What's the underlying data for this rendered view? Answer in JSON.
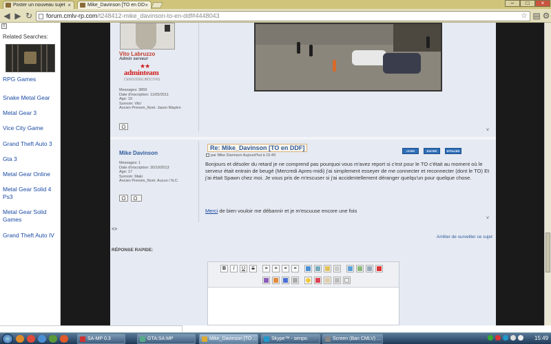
{
  "browser": {
    "tabs": [
      {
        "label": "Poster un nouveau sujet",
        "close": "×"
      },
      {
        "label": "Mike_Davinson [TO en DD",
        "close": "×"
      }
    ],
    "window_controls": [
      "–",
      "□",
      "×"
    ],
    "url": {
      "domain": "forum.cmlv-rp.com",
      "path": "/t248412-mike_davinson-to-en-ddf#4448043"
    }
  },
  "related": {
    "heading": "Related Searches:",
    "links": [
      "RPG Games",
      "Snake Metal Gear",
      "Metal Gear 3",
      "Vice City Game",
      "Grand Theft Auto 3",
      "Gta 3",
      "Metal Gear Online",
      "Metal Gear Solid 4 Ps3",
      "Metal Gear Solid Games",
      "Grand Theft Auto IV"
    ]
  },
  "post1": {
    "username": "Vito Labruzzo",
    "rank": "Admin serveur",
    "stars": "★★",
    "badge": "adminteam",
    "badge_sub": "CENOODIELIBOCITAS",
    "info": [
      "Messages: 3859",
      "Date d'inscription: 11/05/2011",
      "Age: 19",
      "Surnom: Vito'",
      "Ancien Prenom_Nom: Jason Waylen"
    ],
    "expand": "˅"
  },
  "post2": {
    "username": "Mike Davinson",
    "info": [
      "Messages: 1",
      "Date d'inscription: 20/10/2013",
      "Age: 17",
      "Surnom: Maki",
      "Ancien Prenom_Nom: Aucun / N.C."
    ],
    "title": "Re: Mike_Davinson [TO en DDF]",
    "meta": "par Mike Davinson Aujourd'hui à 15:49",
    "buttons": [
      "CITER",
      "EDITER",
      "EFFACER"
    ],
    "body": "Bonjours et désoler du retard je ne comprend pas pourquoi vous m'avez report si c'est pour le TO c'était au moment où le serveur était entrain de beugé (Mercredi Apres-midi) j'ai simplement esseyer de me connecter et reconnecter (dont le TO) Et j'ai était Spawn chez moi. Je vous pris de m'escuser si j'ai accidentellement déranger quelqu'un pour quelque chose.",
    "merci": "Merci",
    "body2": " de bien vouloir me débannir et je m'escuuse encore une fois",
    "expand": "˅"
  },
  "footer": {
    "arrows": "<>",
    "stop_watch": "Arrêter de surveiller ce sujet",
    "quick_reply": "RÉPONSE RAPIDE:"
  },
  "editor": {
    "row1": [
      "B",
      "I",
      "U",
      "S"
    ]
  },
  "taskbar": {
    "tasks": [
      "SA-MP 0.3",
      "GTA:SA:MP",
      "Mike_Davinson [TO ...",
      "Skype™ - senpo.",
      "Screen (Ban CMLV) ..."
    ],
    "clock": "15:49"
  }
}
